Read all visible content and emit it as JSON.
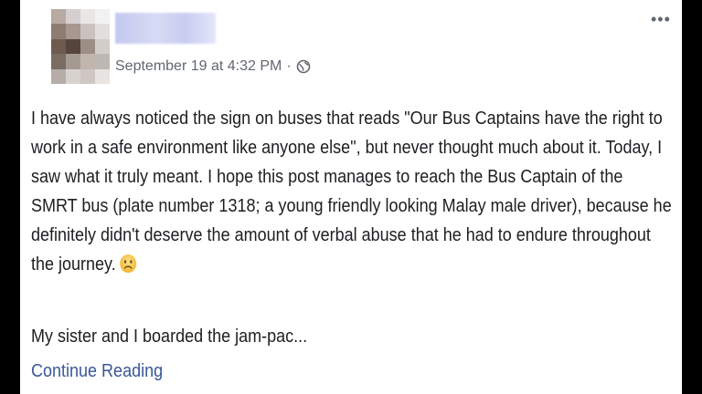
{
  "post": {
    "timestamp": "September 19 at 4:32 PM",
    "separator": "·",
    "privacy_icon": "globe-icon",
    "more_icon": "ellipsis-icon",
    "more_label": "•••",
    "body": "I have always noticed the sign on buses that reads \"Our Bus Captains have the right to work in a safe environment like anyone else\", but never thought much about it. Today, I saw what it truly meant. I hope this post manages to reach the Bus Captain of the SMRT bus (plate number 1318; a young friendly looking Malay male driver), because he definitely didn't deserve the amount of verbal abuse that he had to endure throughout the journey.",
    "emoji": "sad-face-emoji",
    "paragraph2": "My sister and I boarded the jam-pac...",
    "continue_label": "Continue Reading"
  },
  "colors": {
    "link": "#385898",
    "meta": "#616770",
    "text": "#1c1e21",
    "background": "#000000"
  }
}
